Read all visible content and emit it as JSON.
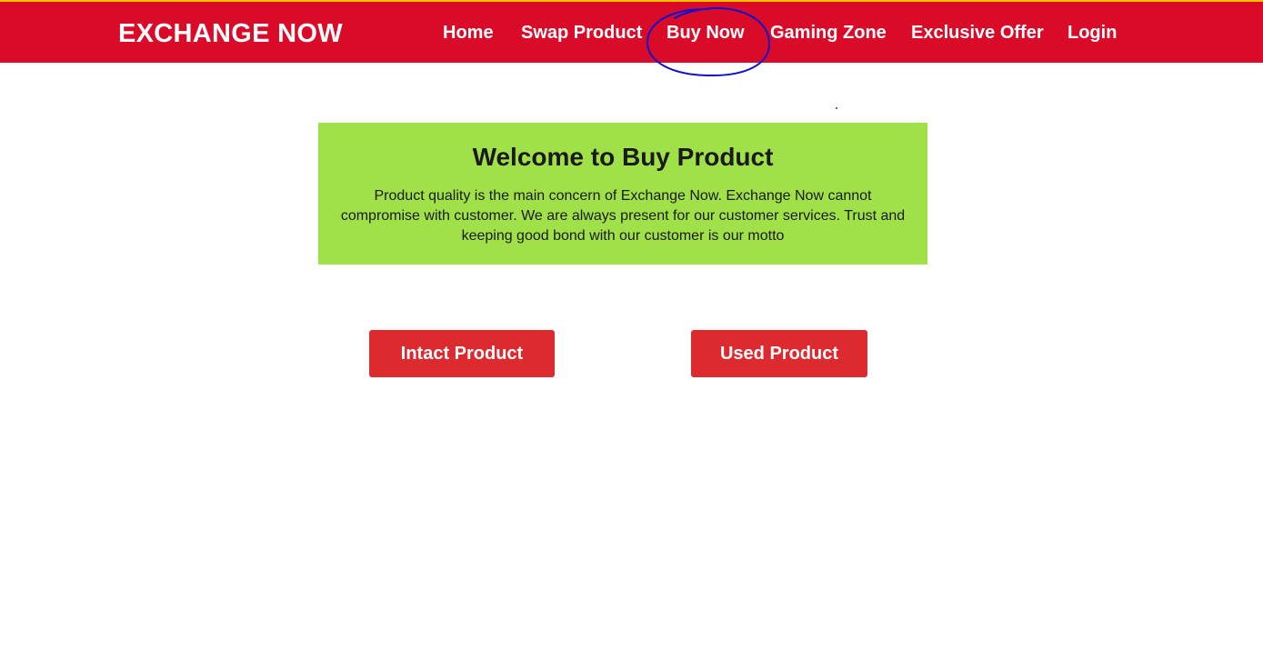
{
  "header": {
    "brand": "EXCHANGE NOW",
    "nav": {
      "home": "Home",
      "swap": "Swap Product",
      "buy": "Buy Now",
      "gaming": "Gaming Zone",
      "offer": "Exclusive Offer",
      "login": "Login"
    }
  },
  "welcome": {
    "title": "Welcome to Buy Product",
    "text": "Product quality is the main concern of Exchange Now. Exchange Now cannot compromise with customer. We are always present for our customer services. Trust and keeping good bond with our customer is our motto"
  },
  "actions": {
    "intact": "Intact Product",
    "used": "Used Product"
  },
  "colors": {
    "header_bg": "#d90b29",
    "header_top_border": "#f2c200",
    "welcome_bg": "#a0e048",
    "button_bg": "#dc2a2e",
    "annotation": "#1010d0"
  }
}
